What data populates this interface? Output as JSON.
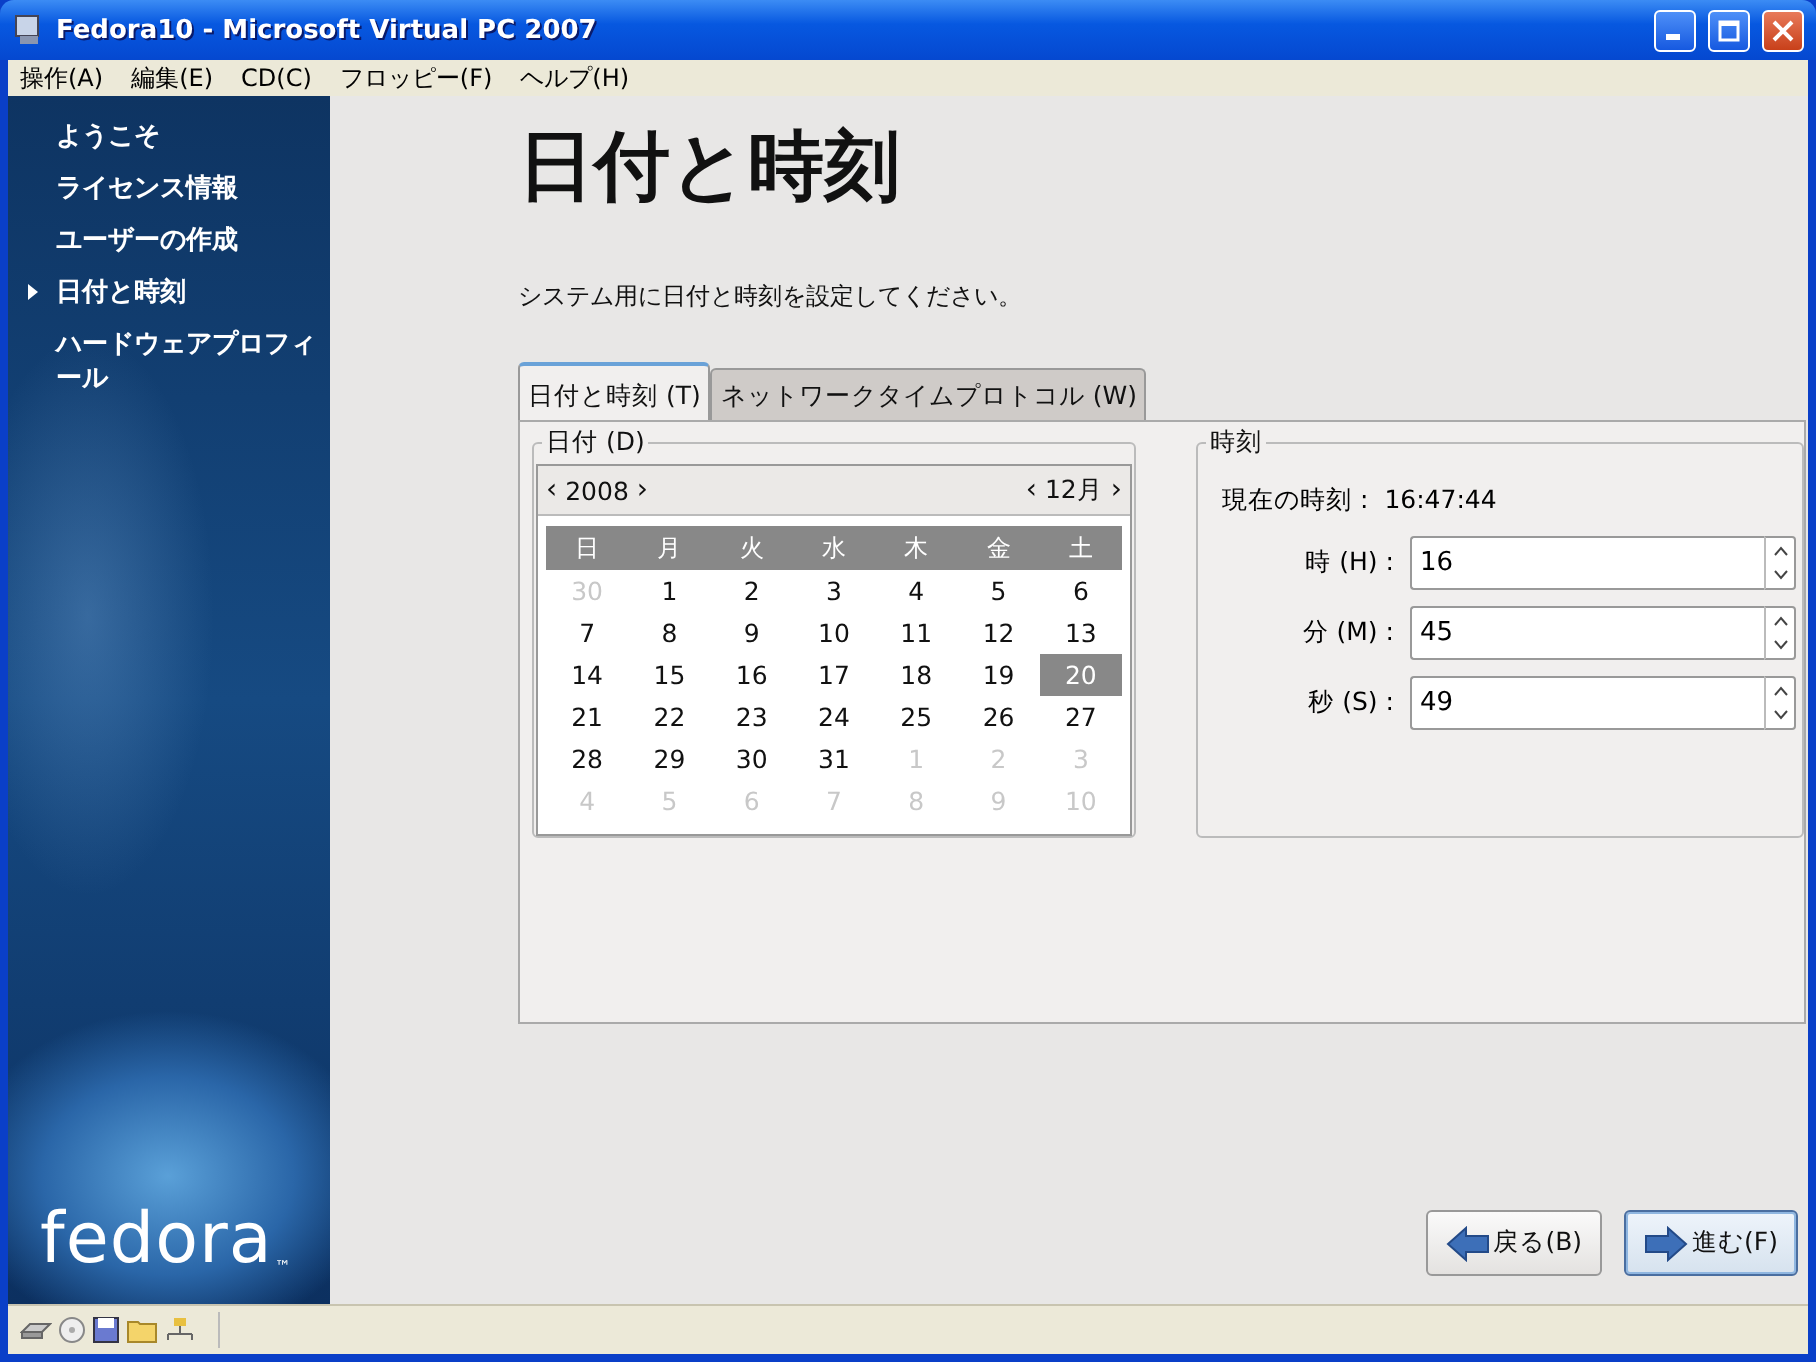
{
  "window": {
    "title": "Fedora10 - Microsoft Virtual PC 2007"
  },
  "menu": [
    "操作(A)",
    "編集(E)",
    "CD(C)",
    "フロッピー(F)",
    "ヘルプ(H)"
  ],
  "sidebar": {
    "items": [
      {
        "label": "ようこそ",
        "selected": false
      },
      {
        "label": "ライセンス情報",
        "selected": false
      },
      {
        "label": "ユーザーの作成",
        "selected": false
      },
      {
        "label": "日付と時刻",
        "selected": true
      },
      {
        "label": "ハードウェアプロフィール",
        "selected": false
      }
    ],
    "logo": "fedora",
    "logo_mark": "™"
  },
  "heading": "日付と時刻",
  "description": "システム用に日付と時刻を設定してください。",
  "tabs": [
    {
      "label": "日付と時刻 (T)",
      "selected": true
    },
    {
      "label": "ネットワークタイムプロトコル (W)",
      "selected": false
    }
  ],
  "date": {
    "title": "日付 (D)",
    "year": "2008",
    "month": "12月",
    "year_nav": [
      "‹",
      "›"
    ],
    "month_nav": [
      "‹",
      "›"
    ],
    "weekdays": [
      "日",
      "月",
      "火",
      "水",
      "木",
      "金",
      "土"
    ],
    "days": [
      {
        "text": "30",
        "other_month": true,
        "selected": false
      },
      {
        "text": "1",
        "other_month": false,
        "selected": false
      },
      {
        "text": "2",
        "other_month": false,
        "selected": false
      },
      {
        "text": "3",
        "other_month": false,
        "selected": false
      },
      {
        "text": "4",
        "other_month": false,
        "selected": false
      },
      {
        "text": "5",
        "other_month": false,
        "selected": false
      },
      {
        "text": "6",
        "other_month": false,
        "selected": false
      },
      {
        "text": "7",
        "other_month": false,
        "selected": false
      },
      {
        "text": "8",
        "other_month": false,
        "selected": false
      },
      {
        "text": "9",
        "other_month": false,
        "selected": false
      },
      {
        "text": "10",
        "other_month": false,
        "selected": false
      },
      {
        "text": "11",
        "other_month": false,
        "selected": false
      },
      {
        "text": "12",
        "other_month": false,
        "selected": false
      },
      {
        "text": "13",
        "other_month": false,
        "selected": false
      },
      {
        "text": "14",
        "other_month": false,
        "selected": false
      },
      {
        "text": "15",
        "other_month": false,
        "selected": false
      },
      {
        "text": "16",
        "other_month": false,
        "selected": false
      },
      {
        "text": "17",
        "other_month": false,
        "selected": false
      },
      {
        "text": "18",
        "other_month": false,
        "selected": false
      },
      {
        "text": "19",
        "other_month": false,
        "selected": false
      },
      {
        "text": "20",
        "other_month": false,
        "selected": true
      },
      {
        "text": "21",
        "other_month": false,
        "selected": false
      },
      {
        "text": "22",
        "other_month": false,
        "selected": false
      },
      {
        "text": "23",
        "other_month": false,
        "selected": false
      },
      {
        "text": "24",
        "other_month": false,
        "selected": false
      },
      {
        "text": "25",
        "other_month": false,
        "selected": false
      },
      {
        "text": "26",
        "other_month": false,
        "selected": false
      },
      {
        "text": "27",
        "other_month": false,
        "selected": false
      },
      {
        "text": "28",
        "other_month": false,
        "selected": false
      },
      {
        "text": "29",
        "other_month": false,
        "selected": false
      },
      {
        "text": "30",
        "other_month": false,
        "selected": false
      },
      {
        "text": "31",
        "other_month": false,
        "selected": false
      },
      {
        "text": "1",
        "other_month": true,
        "selected": false
      },
      {
        "text": "2",
        "other_month": true,
        "selected": false
      },
      {
        "text": "3",
        "other_month": true,
        "selected": false
      },
      {
        "text": "4",
        "other_month": true,
        "selected": false
      },
      {
        "text": "5",
        "other_month": true,
        "selected": false
      },
      {
        "text": "6",
        "other_month": true,
        "selected": false
      },
      {
        "text": "7",
        "other_month": true,
        "selected": false
      },
      {
        "text": "8",
        "other_month": true,
        "selected": false
      },
      {
        "text": "9",
        "other_month": true,
        "selected": false
      },
      {
        "text": "10",
        "other_month": true,
        "selected": false
      }
    ]
  },
  "time": {
    "title": "時刻",
    "current_label": "現在の時刻 :",
    "current": "16:47:44",
    "fields": [
      {
        "label": "時 (H) :",
        "value": "16"
      },
      {
        "label": "分 (M) :",
        "value": "45"
      },
      {
        "label": "秒 (S) :",
        "value": "49"
      }
    ]
  },
  "buttons": [
    {
      "label": "戻る(B)",
      "kind": "back",
      "focused": false
    },
    {
      "label": "進む(F)",
      "kind": "forward",
      "focused": true
    }
  ]
}
